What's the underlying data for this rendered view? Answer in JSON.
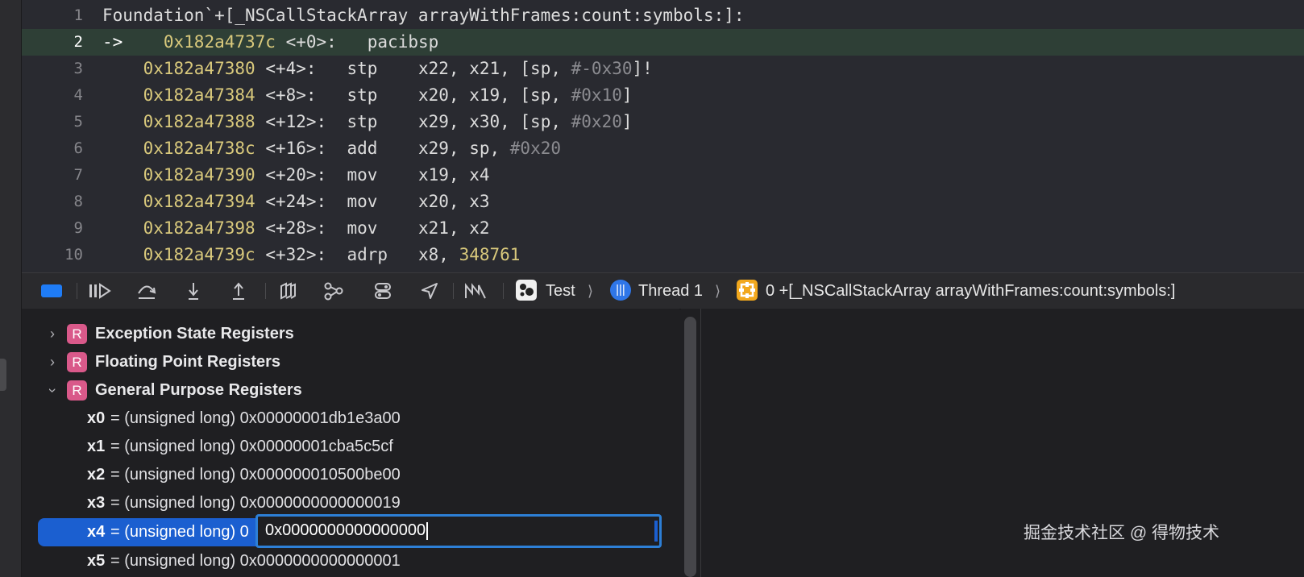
{
  "code": {
    "lines": [
      {
        "num": "1",
        "header": "Foundation`+[_NSCallStackArray arrayWithFrames:count:symbols:]:"
      },
      {
        "num": "2",
        "arrow": "->",
        "addr": "0x182a4737c",
        "offset": "<+0>:",
        "mnemonic": "pacibsp",
        "operands": "",
        "imm": "",
        "tail": ""
      },
      {
        "num": "3",
        "arrow": "",
        "addr": "0x182a47380",
        "offset": "<+4>:",
        "mnemonic": "stp",
        "operands": "x22, x21, [sp, ",
        "imm": "#-0x30",
        "tail": "]!"
      },
      {
        "num": "4",
        "arrow": "",
        "addr": "0x182a47384",
        "offset": "<+8>:",
        "mnemonic": "stp",
        "operands": "x20, x19, [sp, ",
        "imm": "#0x10",
        "tail": "]"
      },
      {
        "num": "5",
        "arrow": "",
        "addr": "0x182a47388",
        "offset": "<+12>:",
        "mnemonic": "stp",
        "operands": "x29, x30, [sp, ",
        "imm": "#0x20",
        "tail": "]"
      },
      {
        "num": "6",
        "arrow": "",
        "addr": "0x182a4738c",
        "offset": "<+16>:",
        "mnemonic": "add",
        "operands": "x29, sp, ",
        "imm": "#0x20",
        "tail": ""
      },
      {
        "num": "7",
        "arrow": "",
        "addr": "0x182a47390",
        "offset": "<+20>:",
        "mnemonic": "mov",
        "operands": "x19, x4",
        "imm": "",
        "tail": ""
      },
      {
        "num": "8",
        "arrow": "",
        "addr": "0x182a47394",
        "offset": "<+24>:",
        "mnemonic": "mov",
        "operands": "x20, x3",
        "imm": "",
        "tail": ""
      },
      {
        "num": "9",
        "arrow": "",
        "addr": "0x182a47398",
        "offset": "<+28>:",
        "mnemonic": "mov",
        "operands": "x21, x2",
        "imm": "",
        "tail": ""
      },
      {
        "num": "10",
        "arrow": "",
        "addr": "0x182a4739c",
        "offset": "<+32>:",
        "mnemonic": "adrp",
        "operands": "x8, ",
        "number": "348761",
        "imm": "",
        "tail": ""
      }
    ]
  },
  "toolbar": {
    "icons": [
      "breakpoints-toggle",
      "continue-icon",
      "step-over-icon",
      "step-into-icon",
      "step-out-icon",
      "debug-view-hierarchy-icon",
      "memory-graph-icon",
      "environment-overrides-icon",
      "simulate-location-icon",
      "metal-capture-icon"
    ],
    "breadcrumb": {
      "app": "Test",
      "thread": "Thread 1",
      "frame": "0 +[_NSCallStackArray arrayWithFrames:count:symbols:]"
    }
  },
  "variables": {
    "groups": [
      {
        "label": "Exception State Registers",
        "expanded": false,
        "badge": "R"
      },
      {
        "label": "Floating Point Registers",
        "expanded": false,
        "badge": "R"
      },
      {
        "label": "General Purpose Registers",
        "expanded": true,
        "badge": "R"
      }
    ],
    "registers": [
      {
        "name": "x0",
        "rest": "= (unsigned long) 0x00000001db1e3a00"
      },
      {
        "name": "x1",
        "rest": "= (unsigned long) 0x00000001cba5c5cf"
      },
      {
        "name": "x2",
        "rest": "= (unsigned long) 0x000000010500be00"
      },
      {
        "name": "x3",
        "rest": "= (unsigned long) 0x0000000000000019"
      },
      {
        "name": "x4",
        "rest": "= (unsigned long) 0"
      },
      {
        "name": "x5",
        "rest": "= (unsigned long) 0x0000000000000001"
      }
    ],
    "edit_value": "0x0000000000000000"
  },
  "watermark": "掘金技术社区 @ 得物技术"
}
